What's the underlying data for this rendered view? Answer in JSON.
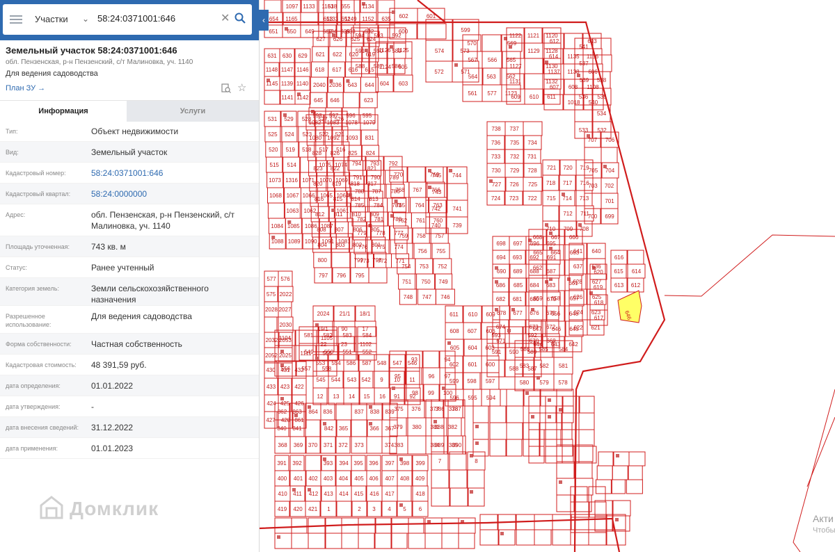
{
  "search": {
    "layer": "Участки",
    "value": "58:24:0371001:646"
  },
  "parcel": {
    "title": "Земельный участок 58:24:0371001:646",
    "address_short": "обл. Пензенская, р-н Пензенский, с/т Малиновка, уч. 1140",
    "purpose": "Для ведения садоводства",
    "plan_link": "План ЗУ →"
  },
  "tabs": [
    {
      "label": "Информация",
      "active": true
    },
    {
      "label": "Услуги",
      "active": false
    }
  ],
  "rows": [
    {
      "key": "Тип:",
      "value": "Объект недвижимости"
    },
    {
      "key": "Вид:",
      "value": "Земельный участок"
    },
    {
      "key": "Кадастровый номер:",
      "value": "58:24:0371001:646",
      "link": true
    },
    {
      "key": "Кадастровый квартал:",
      "value": "58:24:0000000",
      "link": true
    },
    {
      "key": "Адрес:",
      "value": "обл. Пензенская, р-н Пензенский, с/т Малиновка, уч. 1140"
    },
    {
      "key": "Площадь уточненная:",
      "value": "743 кв. м"
    },
    {
      "key": "Статус:",
      "value": "Ранее учтенный"
    },
    {
      "key": "Категория земель:",
      "value": "Земли сельскохозяйственного назначения"
    },
    {
      "key": "Разрешенное использование:",
      "value": "Для ведения садоводства"
    },
    {
      "key": "Форма собственности:",
      "value": "Частная собственность"
    },
    {
      "key": "Кадастровая стоимость:",
      "value": "48 391,59 руб."
    },
    {
      "key": "дата определения:",
      "value": "01.01.2022"
    },
    {
      "key": "дата утверждения:",
      "value": "-"
    },
    {
      "key": "дата внесения сведений:",
      "value": "31.12.2022"
    },
    {
      "key": "дата применения:",
      "value": "01.01.2023"
    }
  ],
  "watermark": "Домклик",
  "activation": {
    "line1": "Акти",
    "line2": "Чтобы"
  },
  "map": {
    "line_color": "#d01c1c",
    "highlight_color": "#ffff66",
    "highlighted": "646",
    "labels": [
      "1097",
      "1133",
      "1151",
      "655",
      "654",
      "1165",
      "653",
      "652",
      "651",
      "650",
      "649",
      "660",
      "639",
      "638",
      "1134",
      "1133",
      "1149",
      "1152",
      "635",
      "634",
      "633",
      "632",
      "631",
      "630",
      "629",
      "1148",
      "1147",
      "1146",
      "1145",
      "1139",
      "1140",
      "1141",
      "1142",
      "627",
      "626",
      "625",
      "624",
      "621",
      "622",
      "620",
      "619",
      "618",
      "617",
      "616",
      "615",
      "2040",
      "2036",
      "643",
      "644",
      "645",
      "646",
      "623",
      "598",
      "597",
      "596",
      "595",
      "594",
      "593",
      "592",
      "591",
      "590",
      "589",
      "588",
      "587",
      "586",
      "1126",
      "1125",
      "1124",
      "605",
      "604",
      "603",
      "602",
      "601",
      "600",
      "599",
      "574",
      "573",
      "572",
      "571",
      "570",
      "569",
      "567",
      "566",
      "565",
      "564",
      "563",
      "562",
      "561",
      "577",
      "1123",
      "1122",
      "1121",
      "1120",
      "1129",
      "1128",
      "1127",
      "1130",
      "1131",
      "1132",
      "609",
      "610",
      "611",
      "612",
      "613",
      "614",
      "1135",
      "1136",
      "1137",
      "1138",
      "606",
      "607",
      "608",
      "1108",
      "1018",
      "540",
      "541",
      "537",
      "539",
      "538",
      "536",
      "535",
      "534",
      "533",
      "532",
      "531",
      "529",
      "528",
      "527",
      "526",
      "525",
      "524",
      "523",
      "522",
      "521",
      "520",
      "519",
      "518",
      "517",
      "516",
      "515",
      "514",
      "1075",
      "1074",
      "1073",
      "1316",
      "1071",
      "1070",
      "1069",
      "1068",
      "1067",
      "1066",
      "1065",
      "1064",
      "1063",
      "1062",
      "1061",
      "1084",
      "1085",
      "1086",
      "1087",
      "1088",
      "1089",
      "1090",
      "1091",
      "1081",
      "1082",
      "1083",
      "1078",
      "1079",
      "1080",
      "1092",
      "1093",
      "831",
      "828",
      "826",
      "825",
      "824",
      "823",
      "822",
      "821",
      "820",
      "819",
      "818",
      "817",
      "816",
      "815",
      "814",
      "813",
      "812",
      "811",
      "810",
      "809",
      "808",
      "807",
      "806",
      "805",
      "804",
      "803",
      "802",
      "801",
      "800",
      "799",
      "798",
      "797",
      "796",
      "795",
      "794",
      "793",
      "792",
      "791",
      "790",
      "789",
      "788",
      "787",
      "786",
      "785",
      "784",
      "783",
      "782",
      "781",
      "780",
      "779",
      "778",
      "777",
      "776",
      "775",
      "774",
      "773",
      "772",
      "771",
      "770",
      "769",
      "768",
      "767",
      "766",
      "765",
      "764",
      "763",
      "762",
      "761",
      "760",
      "759",
      "758",
      "757",
      "756",
      "755",
      "754",
      "753",
      "752",
      "751",
      "750",
      "749",
      "748",
      "747",
      "746",
      "745",
      "744",
      "743",
      "742",
      "741",
      "740",
      "739",
      "738",
      "737",
      "736",
      "735",
      "734",
      "733",
      "732",
      "731",
      "730",
      "729",
      "728",
      "727",
      "726",
      "725",
      "724",
      "723",
      "722",
      "721",
      "720",
      "719",
      "718",
      "717",
      "716",
      "715",
      "714",
      "713",
      "712",
      "711",
      "710",
      "709",
      "708",
      "707",
      "706",
      "705",
      "704",
      "703",
      "702",
      "701",
      "700",
      "699",
      "698",
      "697",
      "696",
      "695",
      "694",
      "693",
      "692",
      "691",
      "690",
      "689",
      "688",
      "687",
      "686",
      "685",
      "684",
      "683",
      "682",
      "681",
      "680",
      "679",
      "678",
      "677",
      "676",
      "675",
      "674",
      "673",
      "672",
      "671",
      "670",
      "669",
      "668",
      "667",
      "666",
      "665",
      "664",
      "663",
      "662",
      "661",
      "659",
      "658",
      "657",
      "656",
      "648",
      "647",
      "646",
      "645",
      "644",
      "643",
      "642",
      "641",
      "640",
      "637",
      "636",
      "628",
      "627",
      "626",
      "625",
      "624",
      "623",
      "622",
      "621",
      "620",
      "619",
      "618",
      "617",
      "616",
      "615",
      "614",
      "613",
      "612",
      "611",
      "610",
      "609",
      "608",
      "607",
      "606",
      "605",
      "604",
      "603",
      "602",
      "601",
      "600",
      "599",
      "598",
      "597",
      "596",
      "595",
      "594",
      "593",
      "592",
      "591",
      "590",
      "589",
      "588",
      "587",
      "586",
      "585",
      "584",
      "583",
      "582",
      "581",
      "580",
      "579",
      "578",
      "577",
      "576",
      "575",
      "2022",
      "2028",
      "2027",
      "2030",
      "2032",
      "2053",
      "2052",
      "2025",
      "2024",
      "21/1",
      "18/1",
      "19/1",
      "90",
      "17",
      "22",
      "23",
      "1102",
      "1104",
      "1105",
      "1111",
      "555",
      "556",
      "557",
      "558",
      "581",
      "582",
      "583",
      "584",
      "549",
      "550",
      "551",
      "552",
      "553",
      "554",
      "586",
      "587",
      "548",
      "547",
      "546",
      "545",
      "544",
      "543",
      "542",
      "9",
      "10",
      "11",
      "12",
      "13",
      "14",
      "15",
      "16",
      "91",
      "92",
      "93",
      "94",
      "95",
      "96",
      "97",
      "98",
      "99",
      "100",
      "430",
      "431",
      "432",
      "433",
      "423",
      "422",
      "424",
      "425",
      "426",
      "427",
      "428",
      "861",
      "862",
      "863",
      "864",
      "836",
      "837",
      "838",
      "839",
      "840",
      "841",
      "842",
      "365",
      "366",
      "367",
      "368",
      "369",
      "370",
      "371",
      "372",
      "373",
      "374",
      "375",
      "376",
      "377",
      "378",
      "379",
      "380",
      "381",
      "382",
      "383",
      "384",
      "385",
      "386",
      "387",
      "388",
      "389",
      "390",
      "391",
      "392",
      "393",
      "394",
      "395",
      "396",
      "397",
      "398",
      "399",
      "400",
      "401",
      "402",
      "403",
      "404",
      "405",
      "406",
      "407",
      "408",
      "409",
      "410",
      "411",
      "412",
      "413",
      "414",
      "415",
      "416",
      "417",
      "418",
      "419",
      "420",
      "421",
      "1",
      "2",
      "3",
      "4",
      "5",
      "6",
      "7",
      "8"
    ]
  }
}
